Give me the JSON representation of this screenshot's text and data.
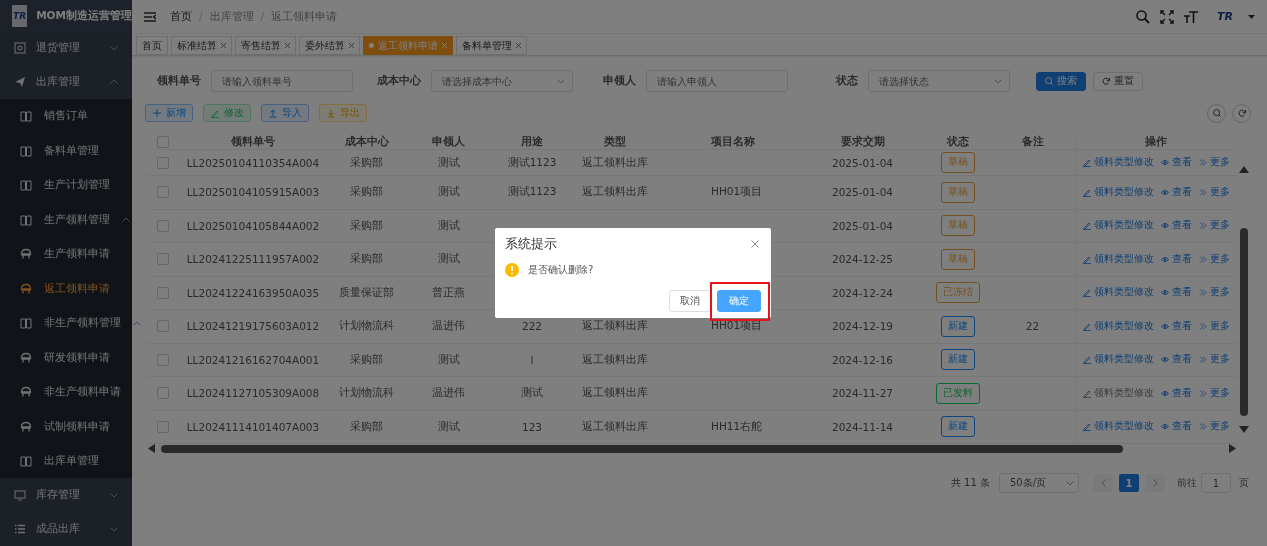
{
  "sidebar": {
    "logo": "TR",
    "title": "MOM制造运营管理",
    "items": [
      {
        "label": "退货管理",
        "kind": "target",
        "expanded": false
      },
      {
        "label": "出库管理",
        "kind": "plane",
        "expanded": true,
        "children": [
          {
            "label": "销售订单",
            "kind": "book",
            "selected": false
          },
          {
            "label": "备料单管理",
            "kind": "book",
            "selected": false
          },
          {
            "label": "生产计划管理",
            "kind": "book",
            "selected": false
          },
          {
            "label": "生产领料管理",
            "kind": "book",
            "expanded": true,
            "children": [
              {
                "label": "生产领料申请",
                "kind": "seat",
                "selected": false
              },
              {
                "label": "返工领料申请",
                "kind": "seat",
                "selected": true
              }
            ]
          },
          {
            "label": "非生产领料管理",
            "kind": "book",
            "expanded": true,
            "children": [
              {
                "label": "研发领料申请",
                "kind": "seat",
                "selected": false
              },
              {
                "label": "非生产领料申请",
                "kind": "seat",
                "selected": false
              },
              {
                "label": "试制领料申请",
                "kind": "seat",
                "selected": false
              }
            ]
          },
          {
            "label": "出库单管理",
            "kind": "book",
            "selected": false
          }
        ]
      },
      {
        "label": "库存管理",
        "kind": "monitor",
        "expanded": false
      },
      {
        "label": "成品出库",
        "kind": "list",
        "expanded": false
      }
    ]
  },
  "header": {
    "breadcrumbs": [
      "首页",
      "出库管理",
      "返工领料申请"
    ],
    "separator": "/",
    "avatar": "TR"
  },
  "tabs": [
    {
      "label": "首页",
      "selected": false,
      "closable": false
    },
    {
      "label": "标准结算",
      "selected": false,
      "closable": true
    },
    {
      "label": "寄售结算",
      "selected": false,
      "closable": true
    },
    {
      "label": "委外结算",
      "selected": false,
      "closable": true
    },
    {
      "label": "返工领料申请",
      "selected": true,
      "closable": true
    },
    {
      "label": "备料单管理",
      "selected": false,
      "closable": true
    }
  ],
  "search_form": {
    "fields": [
      {
        "label": "领料单号",
        "kind": "input",
        "placeholder": "请输入领料单号"
      },
      {
        "label": "成本中心",
        "kind": "select",
        "placeholder": "请选择成本中心"
      },
      {
        "label": "申领人",
        "kind": "input",
        "placeholder": "请输入申领人"
      },
      {
        "label": "状态",
        "kind": "select",
        "placeholder": "请选择状态"
      }
    ],
    "buttons": [
      {
        "label": "搜索",
        "kind": "primary"
      },
      {
        "label": "重置",
        "kind": "plain"
      }
    ]
  },
  "toolbar": [
    {
      "label": "新增",
      "kind": "add"
    },
    {
      "label": "修改",
      "kind": "edit"
    },
    {
      "label": "导入",
      "kind": "import"
    },
    {
      "label": "导出",
      "kind": "export"
    }
  ],
  "table": {
    "all_checked": false,
    "columns": [
      "领料单号",
      "成本中心",
      "申领人",
      "用途",
      "类型",
      "项目名称",
      "要求交期",
      "状态",
      "备注",
      "操作"
    ],
    "rows": [
      {
        "checked": false,
        "no": "LL20250104110354A004",
        "cost_center": "采购部",
        "applicant": "测试",
        "purpose": "测试1123",
        "type": "返工领料出库",
        "due_date": "2025-01-04",
        "status": {
          "label": "草稿",
          "kind": "draft"
        },
        "actions": [
          {
            "label": "领料类型修改",
            "kind": "edit",
            "disabled": false
          },
          {
            "label": "查看",
            "kind": "view",
            "disabled": false
          },
          {
            "label": "更多",
            "kind": "more",
            "disabled": false
          }
        ]
      },
      {
        "checked": false,
        "no": "LL20250104105915A003",
        "cost_center": "采购部",
        "applicant": "测试",
        "purpose": "测试1123",
        "type": "返工领料出库",
        "project": "HH01项目",
        "due_date": "2025-01-04",
        "status": {
          "label": "草稿",
          "kind": "draft"
        },
        "actions": [
          {
            "label": "领料类型修改",
            "kind": "edit",
            "disabled": false
          },
          {
            "label": "查看",
            "kind": "view",
            "disabled": false
          },
          {
            "label": "更多",
            "kind": "more",
            "disabled": false
          }
        ]
      },
      {
        "checked": false,
        "no": "LL20250104105844A002",
        "cost_center": "采购部",
        "applicant": "测试",
        "due_date": "2025-01-04",
        "status": {
          "label": "草稿",
          "kind": "draft"
        },
        "actions": [
          {
            "label": "领料类型修改",
            "kind": "edit",
            "disabled": false
          },
          {
            "label": "查看",
            "kind": "view",
            "disabled": false
          },
          {
            "label": "更多",
            "kind": "more",
            "disabled": false
          }
        ]
      },
      {
        "checked": false,
        "no": "LL20241225111957A002",
        "cost_center": "采购部",
        "applicant": "测试",
        "due_date": "2024-12-25",
        "status": {
          "label": "草稿",
          "kind": "draft"
        },
        "actions": [
          {
            "label": "领料类型修改",
            "kind": "edit",
            "disabled": false
          },
          {
            "label": "查看",
            "kind": "view",
            "disabled": false
          },
          {
            "label": "更多",
            "kind": "more",
            "disabled": false
          }
        ]
      },
      {
        "checked": false,
        "no": "LL20241224163950A035",
        "cost_center": "质量保证部",
        "applicant": "普正燕",
        "due_date": "2024-12-24",
        "status": {
          "label": "已冻结",
          "kind": "frozen"
        },
        "actions": [
          {
            "label": "领料类型修改",
            "kind": "edit",
            "disabled": false
          },
          {
            "label": "查看",
            "kind": "view",
            "disabled": false
          },
          {
            "label": "更多",
            "kind": "more",
            "disabled": false
          }
        ]
      },
      {
        "checked": false,
        "no": "LL20241219175603A012",
        "cost_center": "计划物流科",
        "applicant": "温进伟",
        "purpose": "222",
        "type": "返工领料出库",
        "project": "HH01项目",
        "due_date": "2024-12-19",
        "status": {
          "label": "新建",
          "kind": "new"
        },
        "note": "22",
        "actions": [
          {
            "label": "领料类型修改",
            "kind": "edit",
            "disabled": false
          },
          {
            "label": "查看",
            "kind": "view",
            "disabled": false
          },
          {
            "label": "更多",
            "kind": "more",
            "disabled": false
          }
        ]
      },
      {
        "checked": false,
        "no": "LL20241216162704A001",
        "cost_center": "采购部",
        "applicant": "测试",
        "purpose": "l",
        "type": "返工领料出库",
        "due_date": "2024-12-16",
        "status": {
          "label": "新建",
          "kind": "new"
        },
        "actions": [
          {
            "label": "领料类型修改",
            "kind": "edit",
            "disabled": false
          },
          {
            "label": "查看",
            "kind": "view",
            "disabled": false
          },
          {
            "label": "更多",
            "kind": "more",
            "disabled": false
          }
        ]
      },
      {
        "checked": false,
        "no": "LL20241127105309A008",
        "cost_center": "计划物流科",
        "applicant": "温进伟",
        "purpose": "测试",
        "type": "返工领料出库",
        "due_date": "2024-11-27",
        "status": {
          "label": "已发料",
          "kind": "issued"
        },
        "actions": [
          {
            "label": "领料类型修改",
            "kind": "edit",
            "disabled": true
          },
          {
            "label": "查看",
            "kind": "view",
            "disabled": false
          },
          {
            "label": "更多",
            "kind": "more",
            "disabled": false
          }
        ]
      },
      {
        "checked": false,
        "no": "LL20241114101407A003",
        "cost_center": "采购部",
        "applicant": "测试",
        "purpose": "123",
        "type": "返工领料出库",
        "project": "HH11右舵",
        "due_date": "2024-11-14",
        "status": {
          "label": "新建",
          "kind": "new"
        },
        "actions": [
          {
            "label": "领料类型修改",
            "kind": "edit",
            "disabled": false
          },
          {
            "label": "查看",
            "kind": "view",
            "disabled": false
          },
          {
            "label": "更多",
            "kind": "more",
            "disabled": false
          }
        ]
      }
    ]
  },
  "pagination": {
    "total": "共 11 条",
    "page_size": "50条/页",
    "pages": [
      {
        "label": "1",
        "selected": true
      }
    ],
    "goto_label": "前往",
    "goto_value": "1",
    "goto_suffix": "页"
  },
  "dialog": {
    "title": "系统提示",
    "message": "是否确认删除?",
    "buttons": [
      {
        "label": "取消",
        "kind": "cancel",
        "highlighted": false
      },
      {
        "label": "确定",
        "kind": "primary",
        "highlighted": true
      }
    ]
  }
}
